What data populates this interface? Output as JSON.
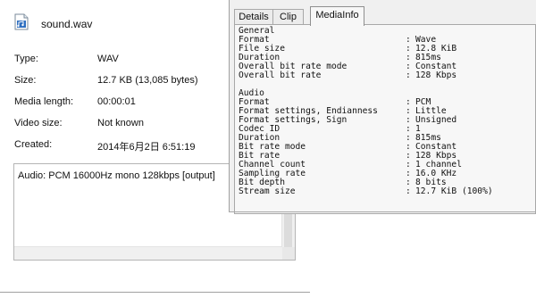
{
  "file": {
    "name": "sound.wav",
    "icon": "audio-file-icon"
  },
  "properties": {
    "type": {
      "label": "Type:",
      "value": "WAV"
    },
    "size": {
      "label": "Size:",
      "value": "12.7 KB (13,085 bytes)"
    },
    "media_length": {
      "label": "Media length:",
      "value": "00:00:01"
    },
    "video_size": {
      "label": "Video size:",
      "value": "Not known"
    },
    "created": {
      "label": "Created:",
      "value": "2014年6月2日 6:51:19"
    }
  },
  "summary": "Audio: PCM 16000Hz mono 128kbps [output]",
  "tabs": [
    {
      "label": "Details"
    },
    {
      "label": "Clip"
    },
    {
      "label": "MediaInfo",
      "active": true
    }
  ],
  "mediainfo": {
    "general_heading": "General",
    "general": [
      {
        "key": "Format",
        "value": "Wave"
      },
      {
        "key": "File size",
        "value": "12.8 KiB"
      },
      {
        "key": "Duration",
        "value": "815ms"
      },
      {
        "key": "Overall bit rate mode",
        "value": "Constant"
      },
      {
        "key": "Overall bit rate",
        "value": "128 Kbps"
      }
    ],
    "audio_heading": "Audio",
    "audio": [
      {
        "key": "Format",
        "value": "PCM"
      },
      {
        "key": "Format settings, Endianness",
        "value": "Little"
      },
      {
        "key": "Format settings, Sign",
        "value": "Unsigned"
      },
      {
        "key": "Codec ID",
        "value": "1"
      },
      {
        "key": "Duration",
        "value": "815ms"
      },
      {
        "key": "Bit rate mode",
        "value": "Constant"
      },
      {
        "key": "Bit rate",
        "value": "128 Kbps"
      },
      {
        "key": "Channel count",
        "value": "1 channel"
      },
      {
        "key": "Sampling rate",
        "value": "16.0 KHz"
      },
      {
        "key": "Bit depth",
        "value": "8 bits"
      },
      {
        "key": "Stream size",
        "value": "12.7 KiB (100%)"
      }
    ],
    "separator": ":"
  },
  "colors": {
    "tab_border": "#a8a8a8",
    "panel_bg": "#f7f7f7",
    "window_bg": "#f0f0f0"
  }
}
